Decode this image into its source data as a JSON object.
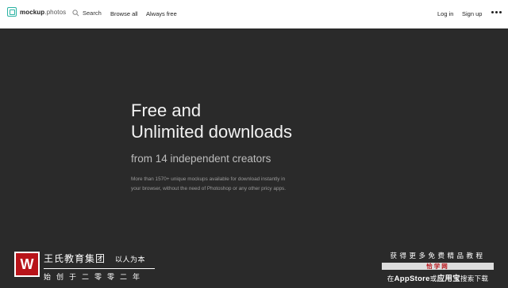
{
  "nav": {
    "logo_bold": "mockup",
    "logo_rest": ".photos",
    "search_label": "Search",
    "browse_label": "Browse all",
    "free_label": "Always free",
    "login_label": "Log in",
    "signup_label": "Sign up"
  },
  "hero": {
    "title_line1": "Free and",
    "title_line2": "Unlimited downloads",
    "subtitle": "from 14 independent creators",
    "description": "More than 1570+ unique mockups available for download instantly in your browser, without the need of Photoshop or any other pricy apps."
  },
  "watermark_left": {
    "badge": "W",
    "name": "王氏教育集团",
    "slogan": "以人为本",
    "since": "始创于二零零二年"
  },
  "watermark_right": {
    "line1": "获得更多免费精品教程",
    "line2": "恰学网",
    "line3_a": "在",
    "line3_b": "AppStore",
    "line3_c": "或",
    "line3_d": "应用宝",
    "line3_e": "搜索下载"
  }
}
